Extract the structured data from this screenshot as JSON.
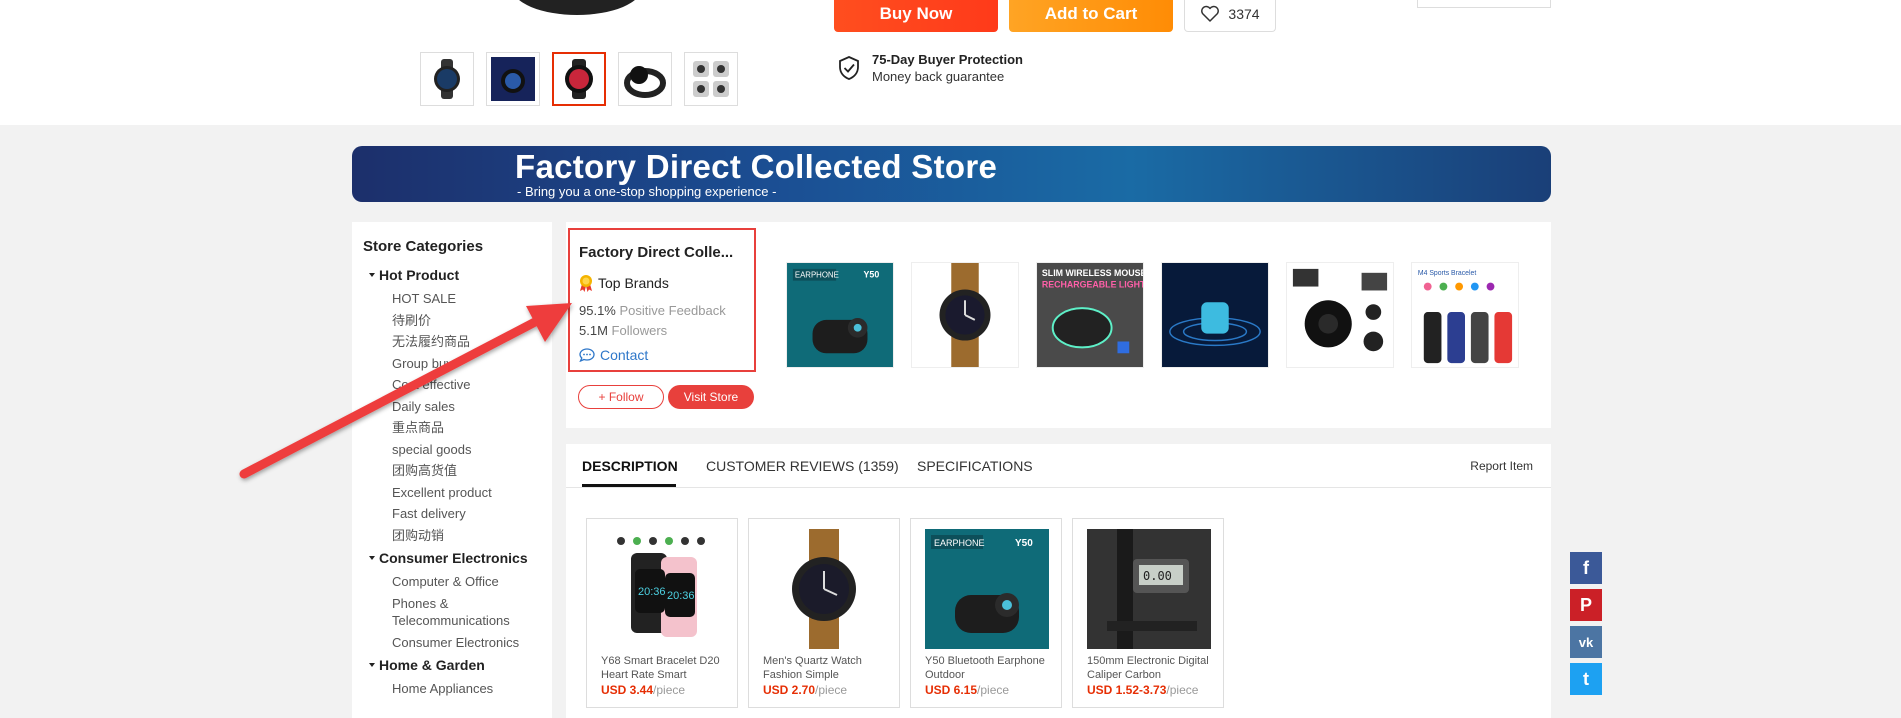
{
  "top": {
    "buy_now": "Buy Now",
    "add_to_cart": "Add to Cart",
    "wishlist_count": "3374",
    "protection_title": "75-Day Buyer Protection",
    "protection_sub": "Money back guarantee"
  },
  "banner": {
    "title": "Factory Direct Collected Store",
    "subtitle": "- Bring you a one-stop shopping experience -"
  },
  "sidebar": {
    "title": "Store Categories",
    "groups": [
      {
        "name": "Hot Product",
        "items": [
          "HOT SALE",
          "待刷价",
          "无法履约商品",
          "Group buy",
          "Cost effective",
          "Daily sales",
          "重点商品",
          "special goods",
          "团购高货值",
          "Excellent product",
          "Fast delivery",
          "团购动销"
        ]
      },
      {
        "name": "Consumer Electronics",
        "items": [
          "Computer & Office",
          "Phones & Telecommunications",
          "Consumer Electronics"
        ]
      },
      {
        "name": "Home & Garden",
        "items": [
          "Home Appliances"
        ]
      }
    ]
  },
  "store": {
    "name": "Factory Direct Colle...",
    "badge": "Top Brands",
    "feedback_value": "95.1%",
    "feedback_label": "Positive Feedback",
    "followers_value": "5.1M",
    "followers_label": "Followers",
    "contact": "Contact",
    "follow": "+ Follow",
    "visit": "Visit Store"
  },
  "tabs": {
    "description": "DESCRIPTION",
    "reviews": "CUSTOMER REVIEWS (1359)",
    "specs": "SPECIFICATIONS",
    "report": "Report Item"
  },
  "products": [
    {
      "name": "Y68 Smart Bracelet D20 Heart Rate Smart",
      "price": "USD 3.44",
      "unit": "/piece"
    },
    {
      "name": "Men's Quartz Watch Fashion Simple",
      "price": "USD 2.70",
      "unit": "/piece"
    },
    {
      "name": "Y50 Bluetooth Earphone Outdoor",
      "price": "USD 6.15",
      "unit": "/piece"
    },
    {
      "name": "150mm Electronic Digital Caliper Carbon",
      "price": "USD 1.52-3.73",
      "unit": "/piece"
    }
  ],
  "social": {
    "facebook": "f",
    "pinterest": "P",
    "vk": "vk",
    "twitter": "t"
  },
  "colors": {
    "accent": "#e8403c",
    "buy": "#ff4e1f",
    "cart": "#ff9a14",
    "link": "#2e77c9",
    "price": "#e62e04"
  }
}
